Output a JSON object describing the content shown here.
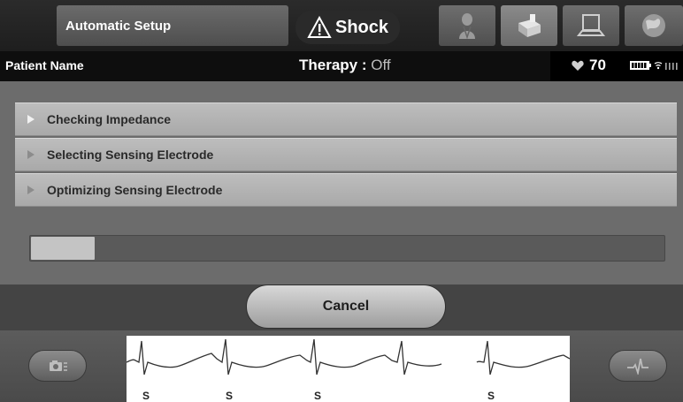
{
  "header": {
    "title": "Automatic Setup",
    "shock_label": "Shock"
  },
  "patient_bar": {
    "patient_name": "Patient Name",
    "therapy_label": "Therapy : ",
    "therapy_value": "Off",
    "heart_rate": "70"
  },
  "steps": [
    {
      "label": "Checking Impedance",
      "active": true
    },
    {
      "label": "Selecting Sensing Electrode",
      "active": false
    },
    {
      "label": "Optimizing Sensing Electrode",
      "active": false
    }
  ],
  "progress": {
    "fraction": 0.1
  },
  "cancel_label": "Cancel",
  "ecg": {
    "sense_markers": [
      "S",
      "S",
      "S",
      "S"
    ]
  },
  "colors": {
    "background": "#3a3a3a",
    "panel": "#6c6c6c",
    "step": "#b3b3b3"
  },
  "icons": [
    "warning-icon",
    "patient-icon",
    "device-icon",
    "laptop-icon",
    "globe-icon",
    "heart-icon",
    "battery-icon",
    "wireless-icon",
    "camera-icon",
    "ecg-icon",
    "play-triangle-icon"
  ]
}
